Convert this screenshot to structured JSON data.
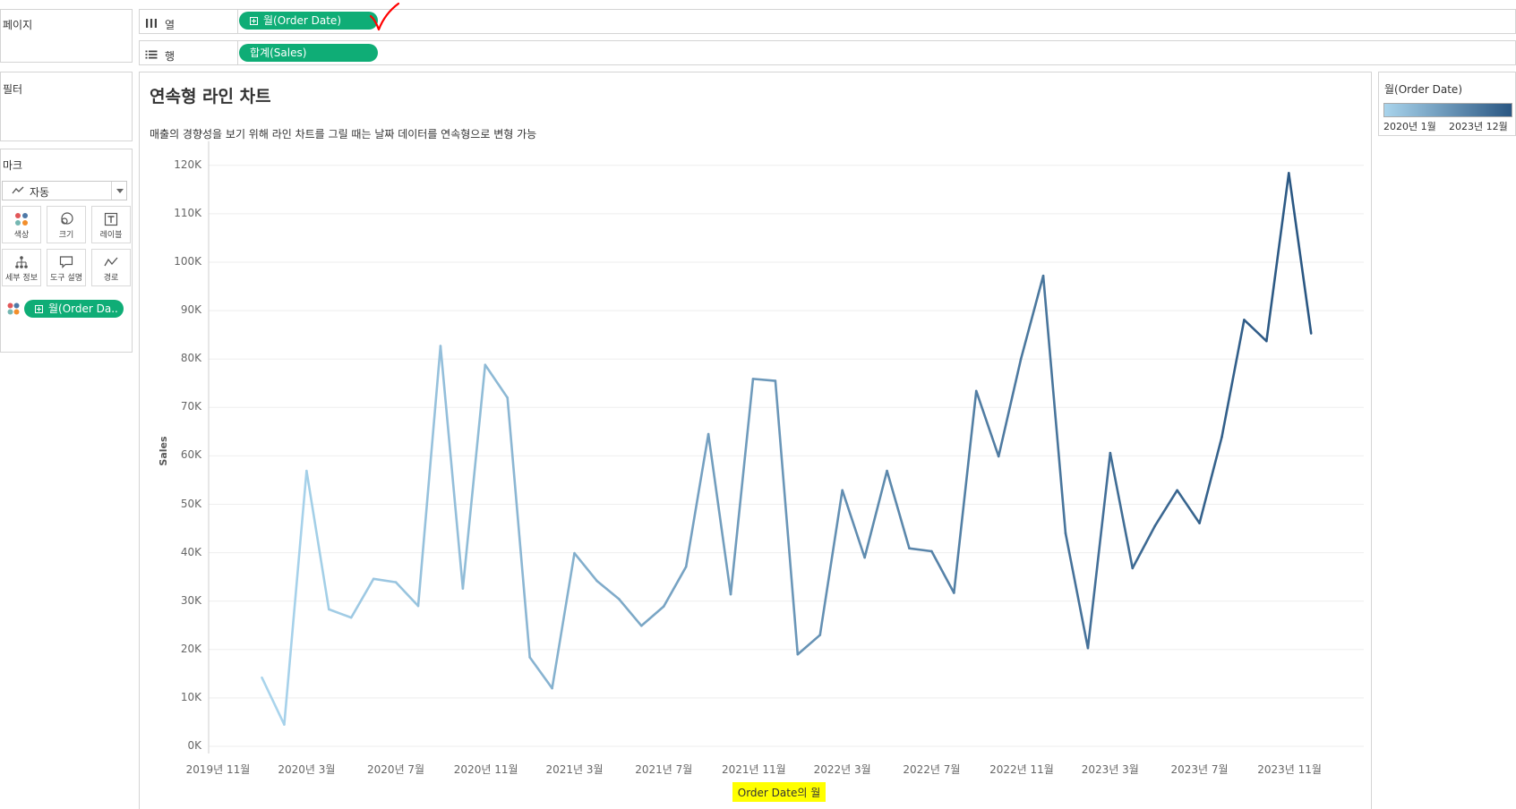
{
  "left_panel": {
    "pages_label": "페이지",
    "filters_label": "필터",
    "marks_label": "마크",
    "mark_type": "자동",
    "mark_buttons": [
      "색상",
      "크기",
      "레이블",
      "세부 정보",
      "도구 설명",
      "경로"
    ],
    "color_pill": "월(Order Da.."
  },
  "shelves": {
    "columns_label": "열",
    "columns_pill": "월(Order Date)",
    "rows_label": "행",
    "rows_pill": "합계(Sales)"
  },
  "legend": {
    "title": "월(Order Date)",
    "min_label": "2020년 1월",
    "max_label": "2023년 12월",
    "color_start": "#a9d4ec",
    "color_end": "#2a5783"
  },
  "colors": {
    "pill": "#0fad76",
    "highlight": "#ffff00",
    "annotation": "#ff0000"
  },
  "chart_data": {
    "type": "line",
    "title": "연속형 라인 차트",
    "subtitle": "매출의 경향성을 보기 위해 라인 차트를 그릴 때는 날짜 데이터를 연속형으로 변형 가능",
    "xlabel": "Order Date의 월",
    "ylabel": "Sales",
    "ylim": [
      0,
      125000
    ],
    "xlim": [
      "2019-11",
      "2024-01"
    ],
    "yticks": [
      "0K",
      "10K",
      "20K",
      "30K",
      "40K",
      "50K",
      "60K",
      "70K",
      "80K",
      "90K",
      "100K",
      "110K",
      "120K"
    ],
    "xticks": [
      "2019년 11월",
      "2020년 3월",
      "2020년 7월",
      "2020년 11월",
      "2021년 3월",
      "2021년 7월",
      "2021년 11월",
      "2022년 3월",
      "2022년 7월",
      "2022년 11월",
      "2023년 3월",
      "2023년 7월",
      "2023년 11월"
    ],
    "x": [
      "2020-01",
      "2020-02",
      "2020-03",
      "2020-04",
      "2020-05",
      "2020-06",
      "2020-07",
      "2020-08",
      "2020-09",
      "2020-10",
      "2020-11",
      "2020-12",
      "2021-01",
      "2021-02",
      "2021-03",
      "2021-04",
      "2021-05",
      "2021-06",
      "2021-07",
      "2021-08",
      "2021-09",
      "2021-10",
      "2021-11",
      "2021-12",
      "2022-01",
      "2022-02",
      "2022-03",
      "2022-04",
      "2022-05",
      "2022-06",
      "2022-07",
      "2022-08",
      "2022-09",
      "2022-10",
      "2022-11",
      "2022-12",
      "2023-01",
      "2023-02",
      "2023-03",
      "2023-04",
      "2023-05",
      "2023-06",
      "2023-07",
      "2023-08",
      "2023-09",
      "2023-10",
      "2023-11",
      "2023-12"
    ],
    "values": [
      14200,
      4500,
      56900,
      28300,
      26600,
      34600,
      33900,
      29000,
      82700,
      32600,
      78800,
      72000,
      18400,
      12000,
      39900,
      34200,
      30400,
      24900,
      28900,
      37100,
      64500,
      31400,
      75900,
      75500,
      19000,
      23000,
      52900,
      39000,
      56900,
      40900,
      40300,
      31700,
      73400,
      59900,
      80000,
      97200,
      44000,
      20300,
      60600,
      36800,
      45500,
      52900,
      46100,
      63900,
      88100,
      83700,
      118400,
      85300
    ]
  }
}
